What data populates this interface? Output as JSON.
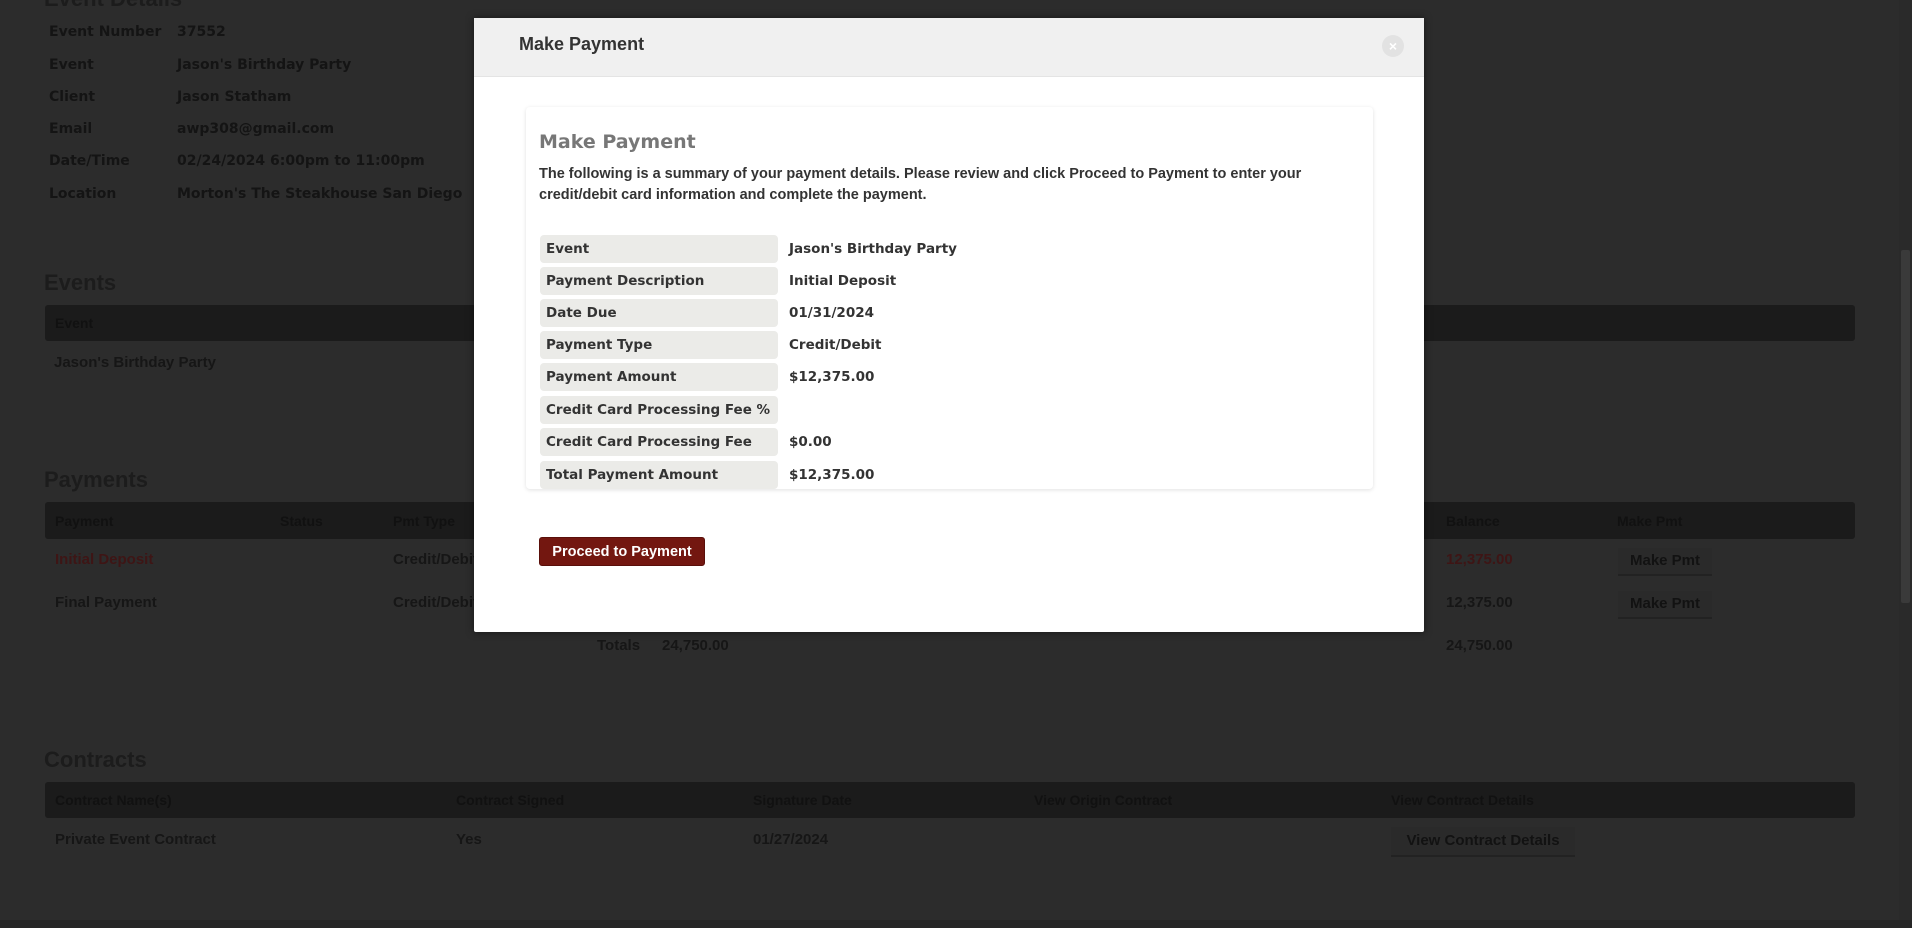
{
  "event_details": {
    "heading": "Event Details",
    "rows": [
      {
        "label": "Event Number",
        "value": "37552"
      },
      {
        "label": "Event",
        "value": "Jason's Birthday Party"
      },
      {
        "label": "Client",
        "value": "Jason Statham"
      },
      {
        "label": "Email",
        "value": "awp308@gmail.com"
      },
      {
        "label": "Date/Time",
        "value": "02/24/2024 6:00pm to 11:00pm"
      },
      {
        "label": "Location",
        "value": "Morton's The Steakhouse San Diego"
      }
    ]
  },
  "events": {
    "heading": "Events",
    "columns": [
      "Event"
    ],
    "rows": [
      [
        "Jason's Birthday Party"
      ]
    ]
  },
  "payments": {
    "heading": "Payments",
    "columns": [
      "Payment",
      "Status",
      "Pmt Type",
      "Balance",
      "Make Pmt"
    ],
    "rows": [
      {
        "payment": "Initial Deposit",
        "type": "Credit/Debit",
        "balance": "12,375.00",
        "action": "Make Pmt"
      },
      {
        "payment": "Final Payment",
        "type": "Credit/Debit",
        "balance": "12,375.00",
        "action": "Make Pmt"
      }
    ],
    "totals_label": "Totals",
    "totals_amount": "24,750.00",
    "totals_balance": "24,750.00"
  },
  "contracts": {
    "heading": "Contracts",
    "columns": [
      "Contract Name(s)",
      "Contract Signed",
      "Signature Date",
      "View Origin Contract",
      "View Contract Details"
    ],
    "rows": [
      {
        "name": "Private Event Contract",
        "signed": "Yes",
        "date": "01/27/2024",
        "action": "View Contract Details"
      }
    ]
  },
  "modal": {
    "title": "Make Payment",
    "close_icon": "close-icon",
    "heading": "Make Payment",
    "intro": "The following is a summary of your payment details. Please review and click Proceed to Payment to enter your credit/debit card information and complete the payment.",
    "rows": [
      {
        "label": "Event",
        "value": "Jason's Birthday Party"
      },
      {
        "label": "Payment Description",
        "value": "Initial Deposit"
      },
      {
        "label": "Date Due",
        "value": "01/31/2024"
      },
      {
        "label": "Payment Type",
        "value": "Credit/Debit"
      },
      {
        "label": "Payment Amount",
        "value": "$12,375.00"
      },
      {
        "label": "Credit Card Processing Fee %",
        "value": ""
      },
      {
        "label": "Credit Card Processing Fee",
        "value": "$0.00"
      },
      {
        "label": "Total Payment Amount",
        "value": "$12,375.00"
      }
    ],
    "proceed_label": "Proceed to Payment"
  },
  "colors": {
    "button": "#731710",
    "overlay": "#2c2c2c",
    "header": "#f0f0f0"
  }
}
